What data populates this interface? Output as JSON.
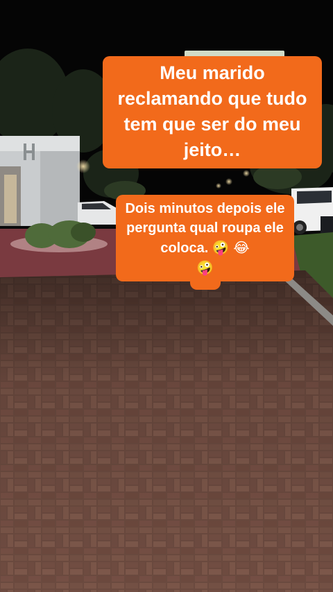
{
  "captions": {
    "top": "Meu marido reclamando que tudo tem que ser do meu jeito…",
    "bottom_text": "Dois minutos depois ele pergunta qual roupa ele coloca.",
    "bottom_emoji_1": "🤪",
    "bottom_emoji_2": "😂",
    "bottom_emoji_3": "🤪"
  },
  "colors": {
    "caption_background": "#f26a1b",
    "caption_text": "#ffffff",
    "pavement": "#6e4a3e",
    "night_sky": "#050505"
  }
}
